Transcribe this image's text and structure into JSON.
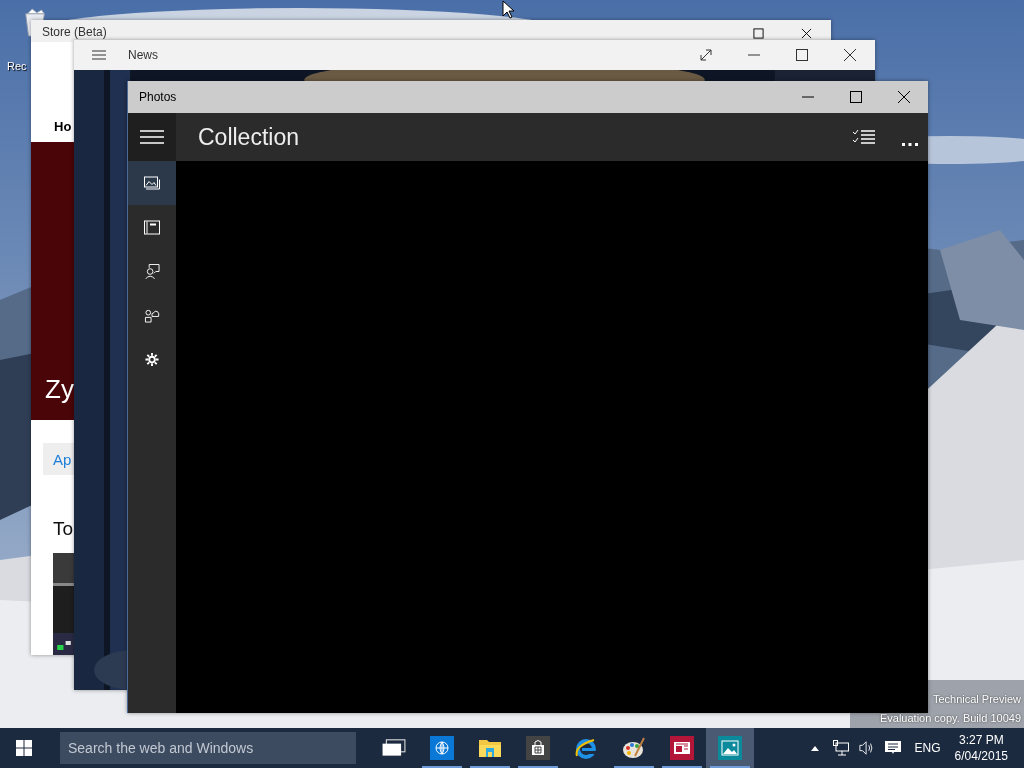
{
  "desktop": {
    "icons": [
      {
        "label": "Rec"
      }
    ],
    "watermark": [
      "Technical Preview",
      "Evaluation copy. Build 10049"
    ]
  },
  "windows": {
    "store": {
      "title": "Store (Beta)",
      "tab": "Ho",
      "banner_text": "Zy",
      "button": "Ap",
      "heading": "To"
    },
    "news": {
      "title": "News"
    },
    "photos": {
      "title": "Photos",
      "page_title": "Collection",
      "nav": [
        {
          "kind": "collection",
          "selected": true
        },
        {
          "kind": "albums",
          "selected": false
        },
        {
          "kind": "people",
          "selected": false
        },
        {
          "kind": "upload",
          "selected": false
        },
        {
          "kind": "settings",
          "selected": false
        }
      ]
    }
  },
  "taskbar": {
    "search": {
      "placeholder": "Search the web and Windows"
    },
    "apps": [
      {
        "kind": "taskview",
        "running": false,
        "selected": false
      },
      {
        "kind": "globe",
        "running": true,
        "selected": false
      },
      {
        "kind": "explorer",
        "running": true,
        "selected": false
      },
      {
        "kind": "store",
        "running": true,
        "selected": false
      },
      {
        "kind": "ie",
        "running": false,
        "selected": false
      },
      {
        "kind": "paint",
        "running": true,
        "selected": false
      },
      {
        "kind": "news",
        "running": true,
        "selected": false
      },
      {
        "kind": "photos",
        "running": true,
        "selected": true
      }
    ],
    "tray": {
      "language": "ENG",
      "time": "3:27 PM",
      "date": "6/04/2015"
    }
  }
}
